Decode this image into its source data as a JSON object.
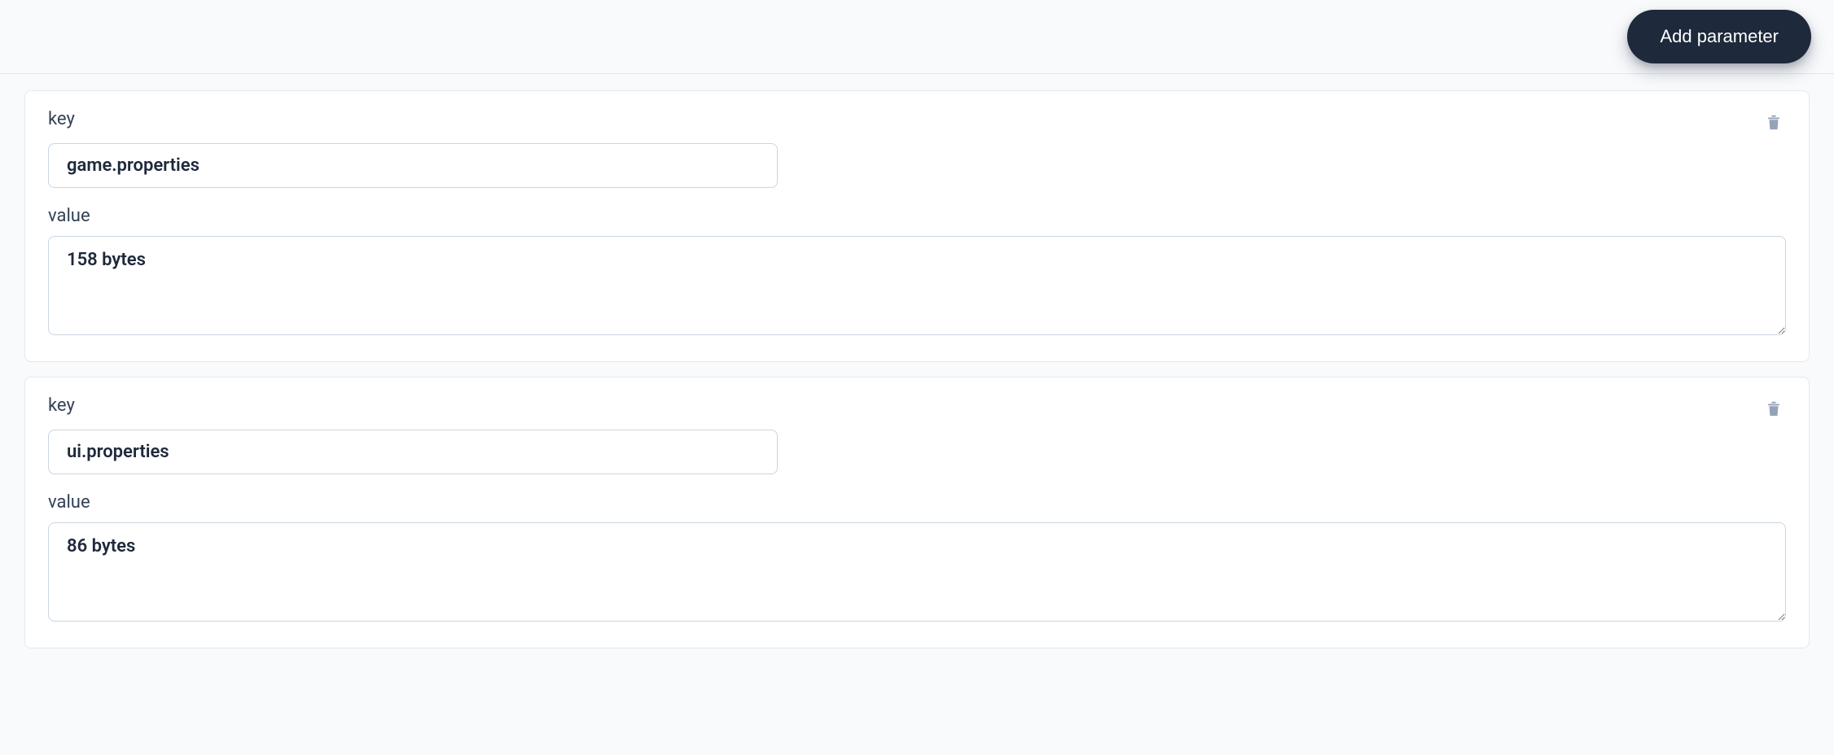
{
  "header": {
    "add_parameter_label": "Add parameter"
  },
  "labels": {
    "key": "key",
    "value": "value"
  },
  "parameters": [
    {
      "key": "game.properties",
      "value": "158 bytes"
    },
    {
      "key": "ui.properties",
      "value": "86 bytes"
    }
  ]
}
